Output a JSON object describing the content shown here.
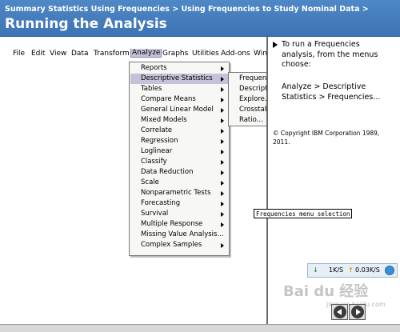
{
  "header": {
    "breadcrumb": "Summary Statistics Using Frequencies > Using Frequencies to Study Nominal Data >",
    "title": "Running the Analysis"
  },
  "menubar": {
    "items": [
      "File",
      "Edit",
      "View",
      "Data",
      "Transform",
      "Analyze",
      "Graphs",
      "Utilities",
      "Add-ons",
      "Win"
    ],
    "active": "Analyze"
  },
  "analyze_menu": {
    "items": [
      {
        "label": "Reports",
        "has_submenu": true
      },
      {
        "label": "Descriptive Statistics",
        "has_submenu": true,
        "highlighted": true
      },
      {
        "label": "Tables",
        "has_submenu": true
      },
      {
        "label": "Compare Means",
        "has_submenu": true
      },
      {
        "label": "General Linear Model",
        "has_submenu": true
      },
      {
        "label": "Mixed Models",
        "has_submenu": true
      },
      {
        "label": "Correlate",
        "has_submenu": true
      },
      {
        "label": "Regression",
        "has_submenu": true
      },
      {
        "label": "Loglinear",
        "has_submenu": true
      },
      {
        "label": "Classify",
        "has_submenu": true
      },
      {
        "label": "Data Reduction",
        "has_submenu": true
      },
      {
        "label": "Scale",
        "has_submenu": true
      },
      {
        "label": "Nonparametric Tests",
        "has_submenu": true
      },
      {
        "label": "Forecasting",
        "has_submenu": true
      },
      {
        "label": "Survival",
        "has_submenu": true
      },
      {
        "label": "Multiple Response",
        "has_submenu": true
      },
      {
        "label": "Missing Value Analysis...",
        "has_submenu": false
      },
      {
        "label": "Complex Samples",
        "has_submenu": true
      }
    ]
  },
  "descriptive_submenu": {
    "items": [
      "Frequenc",
      "Descripti",
      "Explore...",
      "Crosstab",
      "Ratio..."
    ]
  },
  "tooltip": "Frequencies menu selection",
  "instructions": {
    "step": "To run a Frequencies analysis, from the menus choose:",
    "path": "Analyze > Descriptive Statistics > Frequencies...",
    "copyright": "© Copyright IBM Corporation 1989, 2011."
  },
  "netbar": {
    "down_icon": "↓",
    "down": "1K/S",
    "up_icon": "↑",
    "up": "0.03K/S"
  },
  "watermark": {
    "logo": "Bai du 经验",
    "sub": "jingyan.baidu.com"
  },
  "nav": {
    "prev": "previous-arrow-icon",
    "next": "next-arrow-icon"
  },
  "colors": {
    "banner": "#3d74b4",
    "highlight": "#c7c0d9"
  }
}
